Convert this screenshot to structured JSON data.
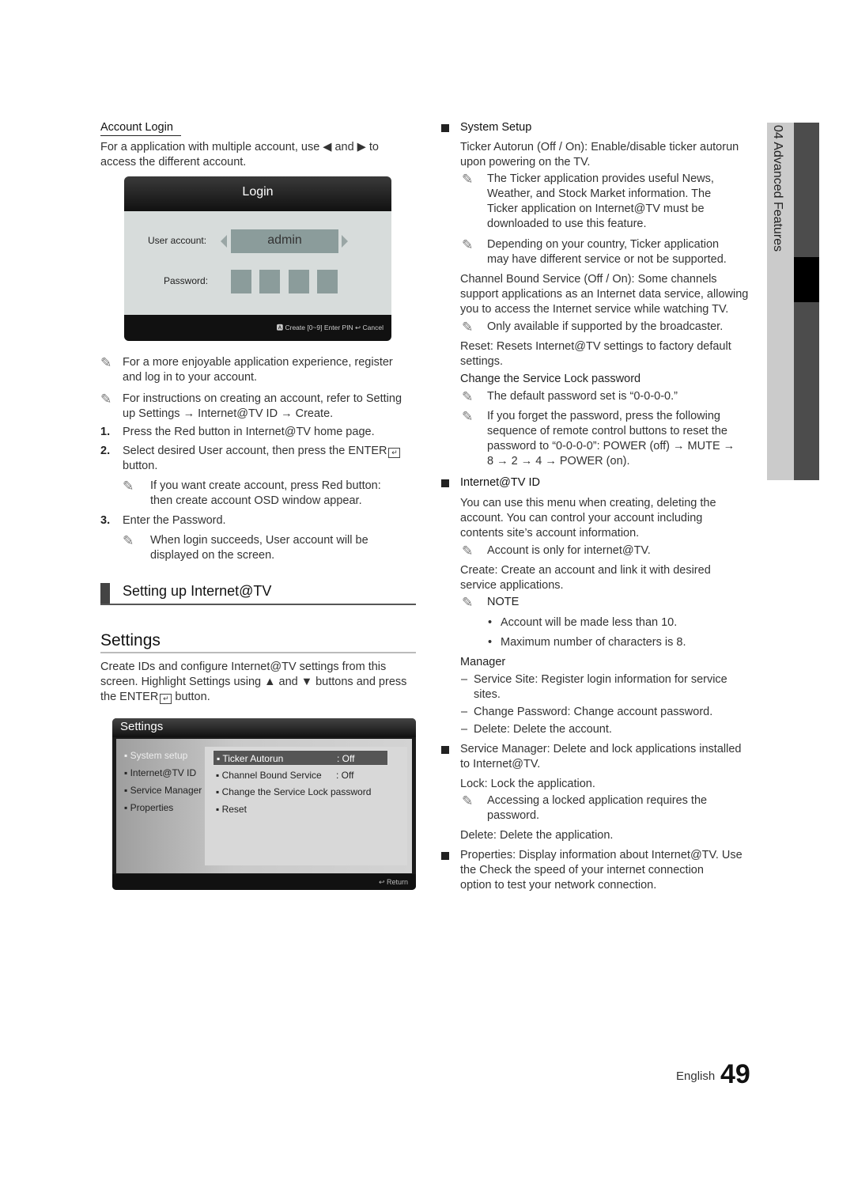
{
  "left": {
    "account_login_heading": "Account Login",
    "account_login_text": [
      "For a application with multiple account, use ◀ and ▶ to",
      "access the different account."
    ],
    "login_osd": {
      "title": "Login",
      "user_account_label": "User account:",
      "user_account_value": "admin",
      "password_label": "Password:",
      "footer": "🅰 Create  [0~9] Enter PIN  ↩ Cancel"
    },
    "notes": [
      [
        "For a more enjoyable application experience, register",
        "and log in to your account."
      ],
      [
        "For instructions on creating an account, refer to Setting",
        "up Settings → Internet@TV ID → Create."
      ]
    ],
    "steps": [
      {
        "num": "1.",
        "lines": [
          "Press the Red button in Internet@TV home page."
        ]
      },
      {
        "num": "2.",
        "lines": [
          "Select desired User account, then press the ENTER",
          "button."
        ],
        "note": [
          "If you want create account, press Red button:",
          "then create account OSD window appear."
        ]
      },
      {
        "num": "3.",
        "lines": [
          "Enter the Password."
        ],
        "note": [
          "When login succeeds, User account will be",
          "displayed on the screen."
        ]
      }
    ],
    "section_heading": "Setting up Internet@TV",
    "settings_title": "Settings",
    "settings_text": [
      "Create IDs and configure Internet@TV settings from this",
      "screen. Highlight Settings using ▲ and ▼ buttons and press",
      "the ENTER",
      "button."
    ],
    "settings_osd": {
      "title": "Settings",
      "left_menu": [
        "System setup",
        "Internet@TV ID",
        "Service Manager",
        "Properties"
      ],
      "left_selected": 0,
      "right_menu": [
        {
          "label": "Ticker Autorun",
          "value": ": Off"
        },
        {
          "label": "Channel Bound Service",
          "value": ": Off"
        },
        {
          "label": "Change the Service Lock password",
          "value": ""
        },
        {
          "label": "Reset",
          "value": ""
        }
      ],
      "right_selected": 0,
      "footer": "↩ Return"
    }
  },
  "right": {
    "system_setup": "System Setup",
    "ticker_line": [
      "Ticker Autorun (Off / On): Enable/disable ticker autorun",
      "upon powering on the TV."
    ],
    "ticker_note1": [
      "The Ticker application provides useful News,",
      "Weather, and Stock Market information. The",
      "Ticker application on Internet@TV must be",
      "downloaded to use this feature."
    ],
    "ticker_note2": [
      "Depending on your country, Ticker application",
      "may have different service or not be supported."
    ],
    "channel_bound": [
      "Channel Bound Service (Off / On): Some channels",
      "support applications as an Internet data service, allowing",
      "you to access the Internet service while watching TV."
    ],
    "channel_note": "Only available if supported by the broadcaster.",
    "reset": [
      "Reset: Resets Internet@TV settings to factory default",
      "settings."
    ],
    "change_lock": "Change the Service Lock password",
    "lock_note1": "The default password set is “0-0-0-0.”",
    "lock_note2": [
      "If you forget the password, press the following",
      "sequence of remote control buttons to reset the",
      "password to “0-0-0-0”: POWER (off) → MUTE →",
      "8 → 2 → 4 → POWER (on)."
    ],
    "id_heading": "Internet@TV ID",
    "id_text": [
      "You can use this menu when creating, deleting the",
      "account. You can control your account including",
      "contents site’s account information."
    ],
    "id_note": "Account is only for internet@TV.",
    "create": [
      "Create: Create an account and link it with desired",
      "service applications."
    ],
    "note_label": "NOTE",
    "note_bullets": [
      "Account will be made less than 10.",
      "Maximum number of characters is 8."
    ],
    "manager": "Manager",
    "manager_items": [
      [
        "Service Site: Register login information for service",
        "sites."
      ],
      [
        "Change Password: Change account password."
      ],
      [
        "Delete: Delete the account."
      ]
    ],
    "service_manager": [
      "Service Manager: Delete and lock applications installed",
      "to Internet@TV."
    ],
    "lock": "Lock: Lock the application.",
    "lock_note": [
      "Accessing a locked application requires the",
      "password."
    ],
    "delete": "Delete: Delete the application.",
    "properties": [
      "Properties: Display information about Internet@TV. Use",
      "the Check the speed of your internet connection",
      "option to test your network connection."
    ]
  },
  "side_tab": {
    "chapter": "04  Advanced Features"
  },
  "footer": {
    "language": "English",
    "page": "49"
  }
}
